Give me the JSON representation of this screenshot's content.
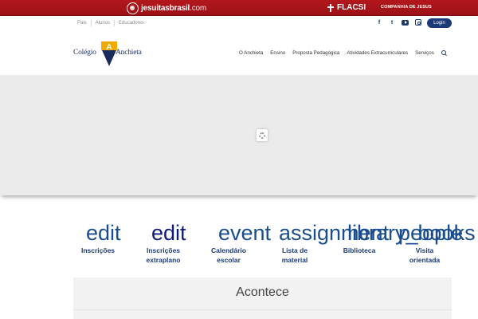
{
  "topbar": {
    "jesuitas": "jesuitasbrasil",
    "jesuitas_suffix": ".com",
    "flacsi": "FLACSI",
    "companhia": "COMPANHIA DE JESUS"
  },
  "subnav": {
    "items": [
      "Pais",
      "Alunos",
      "Educadores"
    ]
  },
  "social": {
    "facebook": "f",
    "twitter": "t",
    "icons": [
      "facebook-icon",
      "twitter-icon",
      "youtube-icon",
      "instagram-icon"
    ]
  },
  "login_label": "Login",
  "logo": {
    "left": "Colégio",
    "right": "Anchieta",
    "letter": "A"
  },
  "mainnav": {
    "items": [
      "O Anchieta",
      "Ensino",
      "Proposta Pedagógica",
      "Atividades Extracurriculares",
      "Serviços"
    ]
  },
  "quicklinks": [
    {
      "icon": "edit",
      "label_1": "Inscrições",
      "label_2": "",
      "color": "#1a4d8f"
    },
    {
      "icon": "edit",
      "label_1": "Inscrições",
      "label_2": "extraplano",
      "color": "#101a7a"
    },
    {
      "icon": "event",
      "label_1": "Calendário",
      "label_2": "escolar",
      "color": "#1a4d8f"
    },
    {
      "icon": "assignment",
      "label_1": "Lista de",
      "label_2": "material",
      "color": "#1a4d8f"
    },
    {
      "icon": "library_books",
      "label_1": "Biblioteca",
      "label_2": "",
      "color": "#1a4d8f"
    },
    {
      "icon": "people",
      "label_1": "Visita",
      "label_2": "orientada",
      "color": "#1a4d8f"
    }
  ],
  "acontece_title": "Acontece",
  "colors": {
    "topbar": "#b3171c",
    "primary": "#1a3a78",
    "slider_bg": "#ebebeb"
  }
}
